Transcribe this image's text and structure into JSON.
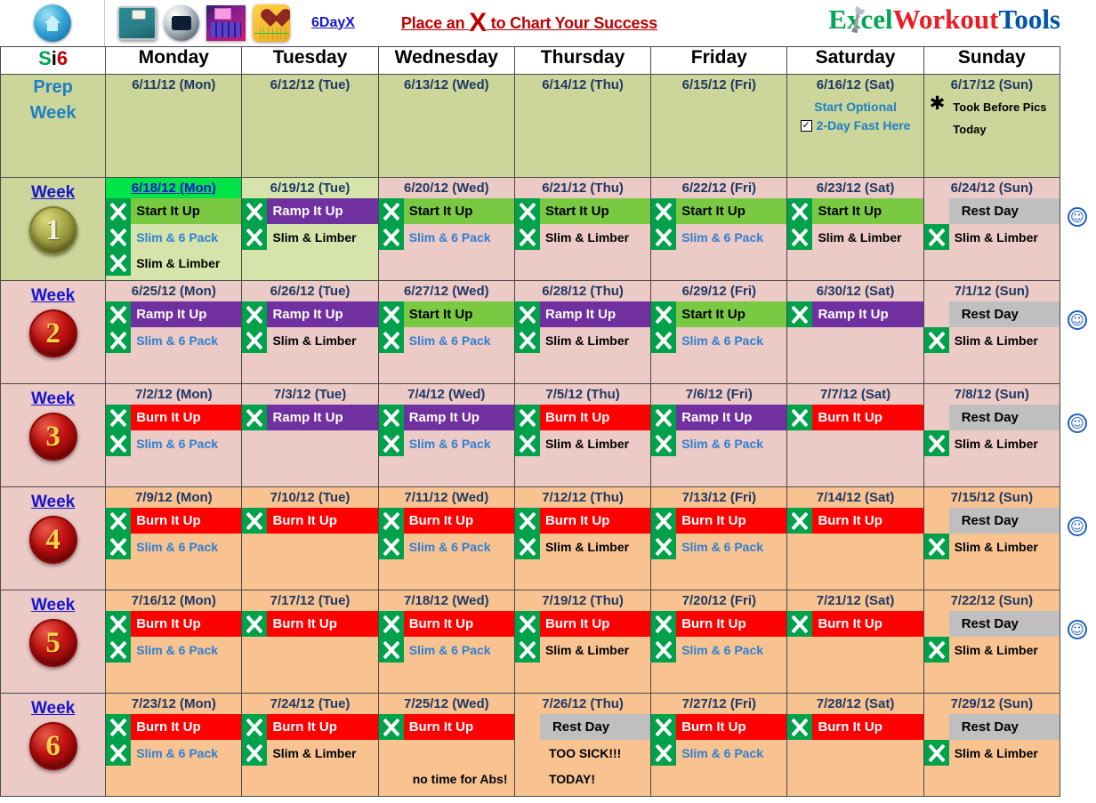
{
  "toolbar": {
    "icons": [
      {
        "name": "home-icon",
        "label": "Home"
      },
      {
        "name": "scale-icon",
        "label": "Weight Scale"
      },
      {
        "name": "camera-icon",
        "label": "Camera"
      },
      {
        "name": "calculator-icon",
        "label": "Calculator"
      },
      {
        "name": "heart-monitor-icon",
        "label": "Heart Monitor"
      }
    ],
    "day_link": "6DayX",
    "tagline_pre": "Place an ",
    "tagline_x": "X",
    "tagline_post": " to Chart Your Success",
    "brand": {
      "part1": "E",
      "part2": "xcel",
      "part3": "Workout",
      "part4": "Tools"
    },
    "colors": {
      "brand_green": "#00a651",
      "brand_red": "#ed1c24",
      "brand_blue": "#0054a6",
      "tagline": "#c00000"
    }
  },
  "header": {
    "corner": {
      "s": "S",
      "i": "i",
      "six": "6"
    },
    "days": [
      "Monday",
      "Tuesday",
      "Wednesday",
      "Thursday",
      "Friday",
      "Saturday",
      "Sunday"
    ]
  },
  "legend_colors": {
    "start_it_up": "#7ac943",
    "ramp_it_up": "#7030a0",
    "burn_it_up": "#ff0000",
    "rest_day": "#bfbfbf",
    "x_mark": "#00a14b",
    "prep_bg": "#ccd69b",
    "week_pink_bg": "#eccac6",
    "week_orange_bg": "#f8c391"
  },
  "labels": {
    "prep_week_line1": "Prep",
    "prep_week_line2": "Week",
    "week_word": "Week",
    "start_it_up": "Start It Up",
    "ramp_it_up": "Ramp It Up",
    "burn_it_up": "Burn It Up",
    "rest_day": "Rest Day",
    "slim_6_pack": "Slim & 6 Pack",
    "slim_limber": "Slim & Limber"
  },
  "prep": {
    "dates": [
      "6/11/12 (Mon)",
      "6/12/12 (Tue)",
      "6/13/12 (Wed)",
      "6/14/12 (Thu)",
      "6/15/12 (Fri)",
      "6/16/12 (Sat)",
      "6/17/12 (Sun)"
    ],
    "sat_note_line1": "Start Optional",
    "sat_note_line2": "2-Day Fast Here",
    "sat_checkbox": "✓",
    "sun_star": "✱",
    "sun_note_line1": "Took  Before Pics",
    "sun_note_line2": "Today"
  },
  "weeks": [
    {
      "num": "1",
      "medal": "gold",
      "bg": "pink",
      "days": [
        {
          "date": "6/18/12 (Mon)",
          "highlight": true,
          "bg": "lgreen",
          "rows": [
            {
              "x": true,
              "label": "Start It Up",
              "type": "start"
            },
            {
              "x": true,
              "label": "Slim & 6 Pack",
              "type": "sixpack"
            },
            {
              "x": true,
              "label": "Slim & Limber",
              "type": "limber"
            }
          ]
        },
        {
          "date": "6/19/12 (Tue)",
          "bg": "lgreen",
          "rows": [
            {
              "x": true,
              "label": "Ramp It Up",
              "type": "ramp"
            },
            {
              "x": true,
              "label": "Slim & Limber",
              "type": "limber"
            }
          ]
        },
        {
          "date": "6/20/12 (Wed)",
          "bg": "pink",
          "rows": [
            {
              "x": true,
              "label": "Start It Up",
              "type": "start"
            },
            {
              "x": true,
              "label": "Slim & 6 Pack",
              "type": "sixpack"
            }
          ]
        },
        {
          "date": "6/21/12 (Thu)",
          "bg": "pink",
          "rows": [
            {
              "x": true,
              "label": "Start It Up",
              "type": "start"
            },
            {
              "x": true,
              "label": "Slim & Limber",
              "type": "limber"
            }
          ]
        },
        {
          "date": "6/22/12 (Fri)",
          "bg": "pink",
          "rows": [
            {
              "x": true,
              "label": "Start It Up",
              "type": "start"
            },
            {
              "x": true,
              "label": "Slim & 6 Pack",
              "type": "sixpack"
            }
          ]
        },
        {
          "date": "6/23/12 (Sat)",
          "bg": "pink",
          "rows": [
            {
              "x": true,
              "label": "Start It Up",
              "type": "start"
            },
            {
              "x": true,
              "label": "Slim & Limber",
              "type": "limber"
            }
          ]
        },
        {
          "date": "6/24/12 (Sun)",
          "bg": "pink",
          "rows": [
            {
              "x": false,
              "label": "Rest Day",
              "type": "rest"
            },
            {
              "x": true,
              "label": "Slim & Limber",
              "type": "limber"
            }
          ]
        }
      ],
      "smiley": true
    },
    {
      "num": "2",
      "medal": "red",
      "bg": "pink",
      "days": [
        {
          "date": "6/25/12 (Mon)",
          "bg": "pink",
          "rows": [
            {
              "x": true,
              "label": "Ramp It Up",
              "type": "ramp"
            },
            {
              "x": true,
              "label": "Slim & 6 Pack",
              "type": "sixpack"
            }
          ]
        },
        {
          "date": "6/26/12 (Tue)",
          "bg": "pink",
          "rows": [
            {
              "x": true,
              "label": "Ramp It Up",
              "type": "ramp"
            },
            {
              "x": true,
              "label": "Slim & Limber",
              "type": "limber"
            }
          ]
        },
        {
          "date": "6/27/12 (Wed)",
          "bg": "pink",
          "rows": [
            {
              "x": true,
              "label": "Start It Up",
              "type": "start"
            },
            {
              "x": true,
              "label": "Slim & 6 Pack",
              "type": "sixpack"
            }
          ]
        },
        {
          "date": "6/28/12 (Thu)",
          "bg": "pink",
          "rows": [
            {
              "x": true,
              "label": "Ramp It Up",
              "type": "ramp"
            },
            {
              "x": true,
              "label": "Slim & Limber",
              "type": "limber"
            }
          ]
        },
        {
          "date": "6/29/12 (Fri)",
          "bg": "pink",
          "rows": [
            {
              "x": true,
              "label": "Start It Up",
              "type": "start"
            },
            {
              "x": true,
              "label": "Slim & 6 Pack",
              "type": "sixpack"
            }
          ]
        },
        {
          "date": "6/30/12 (Sat)",
          "bg": "pink",
          "rows": [
            {
              "x": true,
              "label": "Ramp It Up",
              "type": "ramp"
            }
          ]
        },
        {
          "date": "7/1/12 (Sun)",
          "bg": "pink",
          "rows": [
            {
              "x": false,
              "label": "Rest Day",
              "type": "rest"
            },
            {
              "x": true,
              "label": "Slim & Limber",
              "type": "limber"
            }
          ]
        }
      ],
      "smiley": true
    },
    {
      "num": "3",
      "medal": "red",
      "bg": "pink",
      "days": [
        {
          "date": "7/2/12 (Mon)",
          "bg": "pink",
          "rows": [
            {
              "x": true,
              "label": "Burn It Up",
              "type": "burn"
            },
            {
              "x": true,
              "label": "Slim & 6 Pack",
              "type": "sixpack"
            }
          ]
        },
        {
          "date": "7/3/12 (Tue)",
          "bg": "pink",
          "rows": [
            {
              "x": true,
              "label": "Ramp It Up",
              "type": "ramp"
            }
          ]
        },
        {
          "date": "7/4/12 (Wed)",
          "bg": "pink",
          "rows": [
            {
              "x": true,
              "label": "Ramp It Up",
              "type": "ramp"
            },
            {
              "x": true,
              "label": "Slim & 6 Pack",
              "type": "sixpack"
            }
          ]
        },
        {
          "date": "7/5/12 (Thu)",
          "bg": "pink",
          "rows": [
            {
              "x": true,
              "label": "Burn It Up",
              "type": "burn"
            },
            {
              "x": true,
              "label": "Slim & Limber",
              "type": "limber"
            }
          ]
        },
        {
          "date": "7/6/12 (Fri)",
          "bg": "pink",
          "rows": [
            {
              "x": true,
              "label": "Ramp It Up",
              "type": "ramp"
            },
            {
              "x": true,
              "label": "Slim & 6 Pack",
              "type": "sixpack"
            }
          ]
        },
        {
          "date": "7/7/12 (Sat)",
          "bg": "pink",
          "rows": [
            {
              "x": true,
              "label": "Burn It Up",
              "type": "burn"
            }
          ]
        },
        {
          "date": "7/8/12 (Sun)",
          "bg": "pink",
          "rows": [
            {
              "x": false,
              "label": "Rest Day",
              "type": "rest"
            },
            {
              "x": true,
              "label": "Slim & Limber",
              "type": "limber"
            }
          ]
        }
      ],
      "smiley": true
    },
    {
      "num": "4",
      "medal": "red",
      "bg": "orange",
      "days": [
        {
          "date": "7/9/12 (Mon)",
          "bg": "orange",
          "rows": [
            {
              "x": true,
              "label": "Burn It Up",
              "type": "burn"
            },
            {
              "x": true,
              "label": "Slim & 6 Pack",
              "type": "sixpack"
            }
          ]
        },
        {
          "date": "7/10/12 (Tue)",
          "bg": "orange",
          "rows": [
            {
              "x": true,
              "label": "Burn It Up",
              "type": "burn"
            }
          ]
        },
        {
          "date": "7/11/12 (Wed)",
          "bg": "orange",
          "rows": [
            {
              "x": true,
              "label": "Burn It Up",
              "type": "burn"
            },
            {
              "x": true,
              "label": "Slim & 6 Pack",
              "type": "sixpack"
            }
          ]
        },
        {
          "date": "7/12/12 (Thu)",
          "bg": "orange",
          "rows": [
            {
              "x": true,
              "label": "Burn It Up",
              "type": "burn"
            },
            {
              "x": true,
              "label": "Slim & Limber",
              "type": "limber"
            }
          ]
        },
        {
          "date": "7/13/12 (Fri)",
          "bg": "orange",
          "rows": [
            {
              "x": true,
              "label": "Burn It Up",
              "type": "burn"
            },
            {
              "x": true,
              "label": "Slim & 6 Pack",
              "type": "sixpack"
            }
          ]
        },
        {
          "date": "7/14/12 (Sat)",
          "bg": "orange",
          "rows": [
            {
              "x": true,
              "label": "Burn It Up",
              "type": "burn"
            }
          ]
        },
        {
          "date": "7/15/12 (Sun)",
          "bg": "orange",
          "rows": [
            {
              "x": false,
              "label": "Rest Day",
              "type": "rest"
            },
            {
              "x": true,
              "label": "Slim & Limber",
              "type": "limber"
            }
          ]
        }
      ],
      "smiley": true
    },
    {
      "num": "5",
      "medal": "red",
      "bg": "orange",
      "days": [
        {
          "date": "7/16/12 (Mon)",
          "bg": "orange",
          "rows": [
            {
              "x": true,
              "label": "Burn It Up",
              "type": "burn"
            },
            {
              "x": true,
              "label": "Slim & 6 Pack",
              "type": "sixpack"
            }
          ]
        },
        {
          "date": "7/17/12 (Tue)",
          "bg": "orange",
          "rows": [
            {
              "x": true,
              "label": "Burn It Up",
              "type": "burn"
            }
          ]
        },
        {
          "date": "7/18/12 (Wed)",
          "bg": "orange",
          "rows": [
            {
              "x": true,
              "label": "Burn It Up",
              "type": "burn"
            },
            {
              "x": true,
              "label": "Slim & 6 Pack",
              "type": "sixpack"
            }
          ]
        },
        {
          "date": "7/19/12 (Thu)",
          "bg": "orange",
          "rows": [
            {
              "x": true,
              "label": "Burn It Up",
              "type": "burn"
            },
            {
              "x": true,
              "label": "Slim & Limber",
              "type": "limber"
            }
          ]
        },
        {
          "date": "7/20/12 (Fri)",
          "bg": "orange",
          "rows": [
            {
              "x": true,
              "label": "Burn It Up",
              "type": "burn"
            },
            {
              "x": true,
              "label": "Slim & 6 Pack",
              "type": "sixpack"
            }
          ]
        },
        {
          "date": "7/21/12 (Sat)",
          "bg": "orange",
          "rows": [
            {
              "x": true,
              "label": "Burn It Up",
              "type": "burn"
            }
          ]
        },
        {
          "date": "7/22/12 (Sun)",
          "bg": "orange",
          "rows": [
            {
              "x": false,
              "label": "Rest Day",
              "type": "rest"
            },
            {
              "x": true,
              "label": "Slim & Limber",
              "type": "limber"
            }
          ]
        }
      ],
      "smiley": true
    },
    {
      "num": "6",
      "medal": "red",
      "bg": "orange",
      "days": [
        {
          "date": "7/23/12 (Mon)",
          "bg": "orange",
          "rows": [
            {
              "x": true,
              "label": "Burn It Up",
              "type": "burn"
            },
            {
              "x": true,
              "label": "Slim & 6 Pack",
              "type": "sixpack"
            }
          ]
        },
        {
          "date": "7/24/12 (Tue)",
          "bg": "orange",
          "rows": [
            {
              "x": true,
              "label": "Burn It Up",
              "type": "burn"
            },
            {
              "x": true,
              "label": "Slim & Limber",
              "type": "limber"
            }
          ]
        },
        {
          "date": "7/25/12 (Wed)",
          "bg": "orange",
          "rows": [
            {
              "x": true,
              "label": "Burn It Up",
              "type": "burn"
            },
            {
              "x": false,
              "label": "",
              "type": "blank"
            },
            {
              "x": false,
              "label": "no time for Abs!",
              "type": "note"
            }
          ]
        },
        {
          "date": "7/26/12 (Thu)",
          "bg": "orange",
          "rows": [
            {
              "x": false,
              "label": "Rest Day",
              "type": "rest"
            },
            {
              "x": false,
              "label": "TOO SICK!!!",
              "type": "note"
            },
            {
              "x": false,
              "label": "TODAY!",
              "type": "note"
            }
          ]
        },
        {
          "date": "7/27/12 (Fri)",
          "bg": "orange",
          "rows": [
            {
              "x": true,
              "label": "Burn It Up",
              "type": "burn"
            },
            {
              "x": true,
              "label": "Slim & 6 Pack",
              "type": "sixpack"
            }
          ]
        },
        {
          "date": "7/28/12 (Sat)",
          "bg": "orange",
          "rows": [
            {
              "x": true,
              "label": "Burn It Up",
              "type": "burn"
            }
          ]
        },
        {
          "date": "7/29/12 (Sun)",
          "bg": "orange",
          "rows": [
            {
              "x": false,
              "label": "Rest Day",
              "type": "rest"
            },
            {
              "x": true,
              "label": "Slim & Limber",
              "type": "limber"
            }
          ]
        }
      ],
      "smiley": false
    }
  ]
}
